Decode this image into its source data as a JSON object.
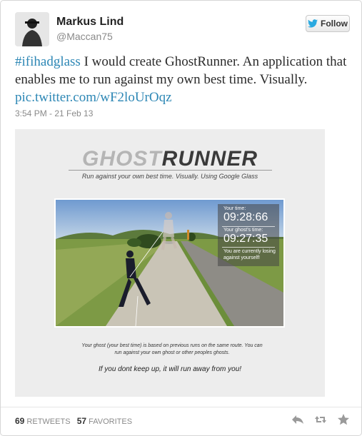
{
  "user": {
    "name": "Markus Lind",
    "handle": "@Maccan75"
  },
  "follow_label": "Follow",
  "tweet": {
    "hashtag": "#ifihadglass",
    "body": " I would create GhostRunner. An application that enables me to run against my own best time. Visually. ",
    "link": "pic.twitter.com/wF2loUrOqz",
    "timestamp": "3:54 PM - 21 Feb 13"
  },
  "media": {
    "logo_a": "GHOST",
    "logo_b": "RUNNER",
    "subtitle": "Run against your own best time. Visually. Using Google Glass",
    "hud": {
      "label1": "Your time:",
      "time1": "09:28:66",
      "label2": "Your ghost's time:",
      "time2": "09:27:35",
      "note": "You are currently losing against yourself!"
    },
    "caption": "Your ghost (your best time) is based on previous runs on the same route. You can run against your own ghost or other peoples ghosts.",
    "tagline": "If you dont keep up, it will run away from you!"
  },
  "stats": {
    "retweets": "69",
    "retweets_label": "RETWEETS",
    "favorites": "57",
    "favorites_label": "FAVORITES"
  },
  "colors": {
    "link": "#2d87b5",
    "twitter_bird": "#2aa9e0"
  }
}
